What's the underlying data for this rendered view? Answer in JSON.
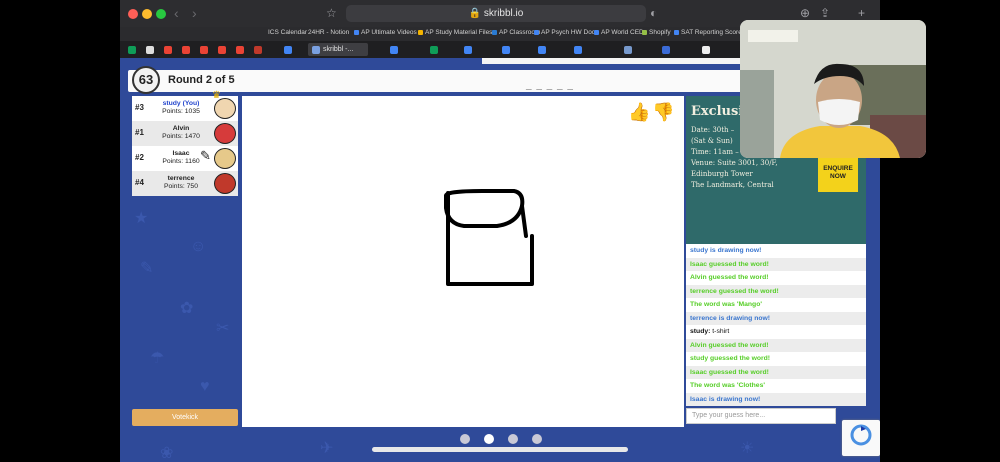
{
  "browser": {
    "url": "skribbl.io",
    "bookmarks": [
      "ICS Calendar",
      "24HR - Notion",
      "AP Ultimate Videos",
      "AP Study Material Files",
      "AP Classroom",
      "AP Psych HW Doc",
      "AP World CED",
      "Shopify",
      "SAT Reporting Scores"
    ],
    "active_tab": "skribbl -..."
  },
  "game": {
    "timer": "63",
    "round": "Round 2 of 5",
    "hint": "_ _ _ _ _",
    "votekick": "Votekick"
  },
  "players": [
    {
      "rank": "#3",
      "name": "study (You)",
      "points": "Points: 1035",
      "is_you": true,
      "avatar_color": "#f0d6b0"
    },
    {
      "rank": "#1",
      "name": "Alvin",
      "points": "Points: 1470",
      "is_you": false,
      "avatar_color": "#d63b3b"
    },
    {
      "rank": "#2",
      "name": "Isaac",
      "points": "Points: 1160",
      "is_you": false,
      "avatar_color": "#e6c98a"
    },
    {
      "rank": "#4",
      "name": "terrence",
      "points": "Points: 750",
      "is_you": false,
      "avatar_color": "#c0392b"
    }
  ],
  "ad": {
    "title": "Exclusiv",
    "lines": [
      "Date: 30th –",
      "(Sat & Sun)",
      "Time: 11am –",
      "Venue: Suite 3001, 30/F,",
      "Edinburgh Tower",
      "The Landmark, Central"
    ],
    "cta": "ENQUIRE NOW"
  },
  "chat": [
    {
      "text": "study is drawing now!",
      "kind": "draw"
    },
    {
      "text": "Isaac guessed the word!",
      "kind": "guess"
    },
    {
      "text": "Alvin guessed the word!",
      "kind": "guess"
    },
    {
      "text": "terrence guessed the word!",
      "kind": "guess"
    },
    {
      "text": "The word was 'Mango'",
      "kind": "guess"
    },
    {
      "text": "terrence is drawing now!",
      "kind": "draw"
    },
    {
      "name": "study:",
      "text": "t-shirt",
      "kind": "msg"
    },
    {
      "text": "Alvin guessed the word!",
      "kind": "guess"
    },
    {
      "text": "study guessed the word!",
      "kind": "guess"
    },
    {
      "text": "Isaac guessed the word!",
      "kind": "guess"
    },
    {
      "text": "The word was 'Clothes'",
      "kind": "guess"
    },
    {
      "text": "Isaac is drawing now!",
      "kind": "draw"
    }
  ],
  "guess_placeholder": "Type your guess here...",
  "colors": {
    "guess": "#56ce27",
    "draw": "#3975ce",
    "page_bg": "#2f4a99",
    "votekick": "#e4ad5f"
  }
}
